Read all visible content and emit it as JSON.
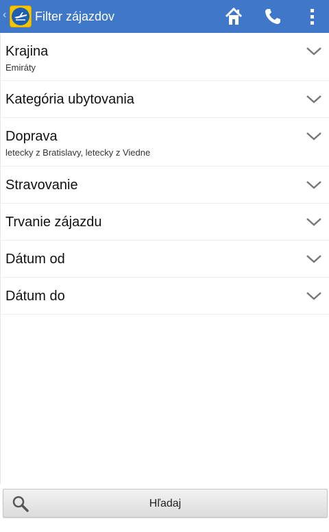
{
  "actionbar": {
    "title": "Filter zájazdov",
    "color": "#3f78c8",
    "actions": [
      {
        "icon": "home-icon"
      },
      {
        "icon": "phone-icon"
      },
      {
        "icon": "overflow-menu-icon"
      }
    ]
  },
  "filters": [
    {
      "title": "Krajina",
      "value": "Emiráty"
    },
    {
      "title": "Kategória ubytovania",
      "value": ""
    },
    {
      "title": "Doprava",
      "value": "letecky z Bratislavy, letecky z Viedne"
    },
    {
      "title": "Stravovanie",
      "value": ""
    },
    {
      "title": "Trvanie zájazdu",
      "value": ""
    },
    {
      "title": "Dátum od",
      "value": ""
    },
    {
      "title": "Dátum do",
      "value": ""
    }
  ],
  "search_button": {
    "label": "Hľadaj",
    "icon": "search-icon"
  }
}
